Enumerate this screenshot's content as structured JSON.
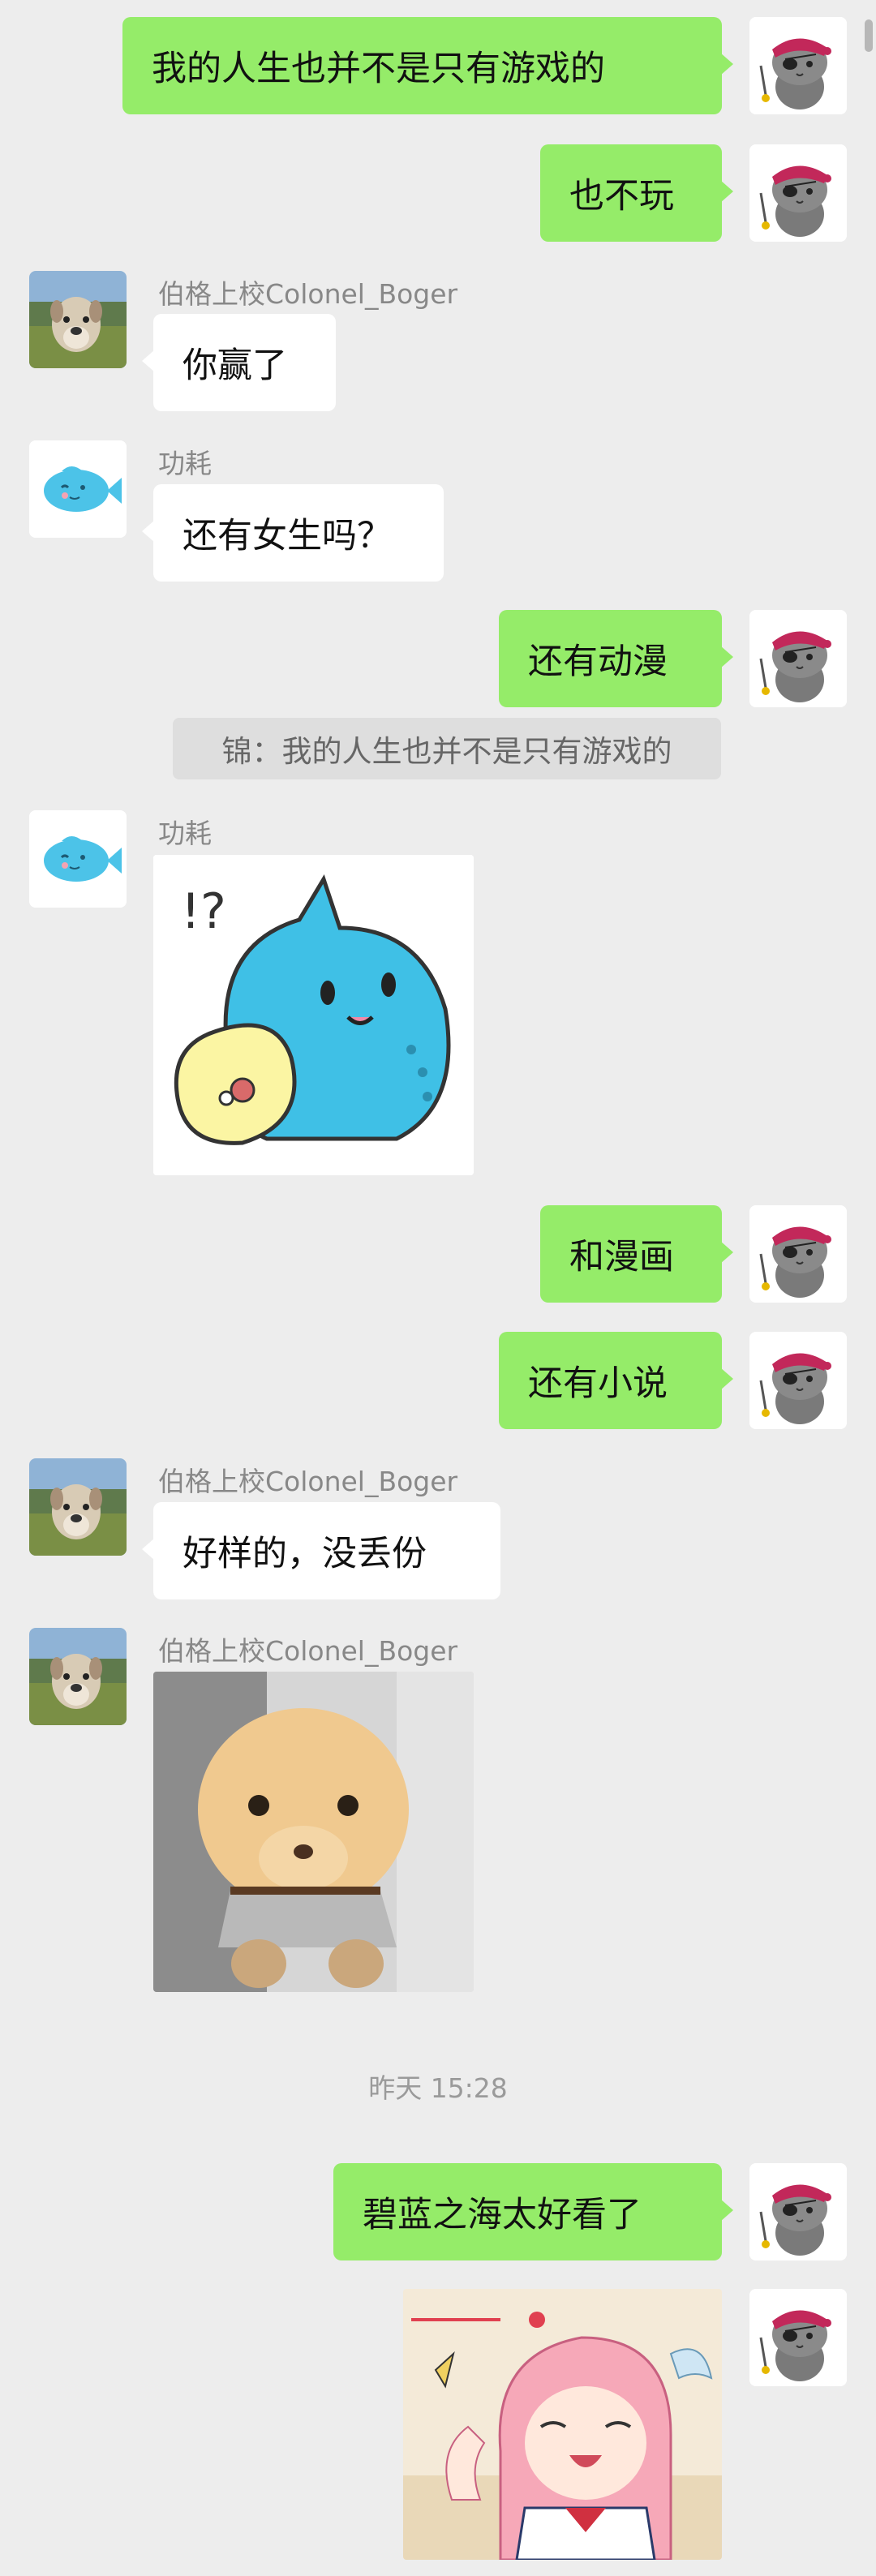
{
  "contacts": {
    "me": {
      "avatar": "pirate-cat-avatar"
    },
    "boger": {
      "name": "伯格上校Colonel_Boger",
      "avatar": "dog-avatar"
    },
    "gonghao": {
      "name": "功耗",
      "avatar": "blue-fish-avatar"
    }
  },
  "messages": [
    {
      "sender": "me",
      "text": "我的人生也并不是只有游戏的"
    },
    {
      "sender": "me",
      "text": "也不玩"
    },
    {
      "sender": "boger",
      "text": "你赢了"
    },
    {
      "sender": "gonghao",
      "text": "还有女生吗？"
    },
    {
      "sender": "me",
      "text": "还有动漫"
    },
    {
      "type": "quote",
      "text": "锦：我的人生也并不是只有游戏的"
    },
    {
      "sender": "gonghao",
      "type": "sticker",
      "sticker": "blue-cat-sticker",
      "text": "!?"
    },
    {
      "sender": "me",
      "text": "和漫画"
    },
    {
      "sender": "me",
      "text": "还有小说"
    },
    {
      "sender": "boger",
      "text": "好样的，没丢份"
    },
    {
      "sender": "boger",
      "type": "image",
      "image": "plush-dog-photo"
    },
    {
      "type": "timestamp",
      "text": "昨天 15:28"
    },
    {
      "sender": "me",
      "text": "碧蓝之海太好看了"
    },
    {
      "sender": "me",
      "type": "sticker",
      "sticker": "anime-girl-sticker"
    }
  ],
  "colors": {
    "background": "#ededed",
    "my_bubble": "#95ec69",
    "other_bubble": "#ffffff",
    "nickname": "#888888"
  }
}
